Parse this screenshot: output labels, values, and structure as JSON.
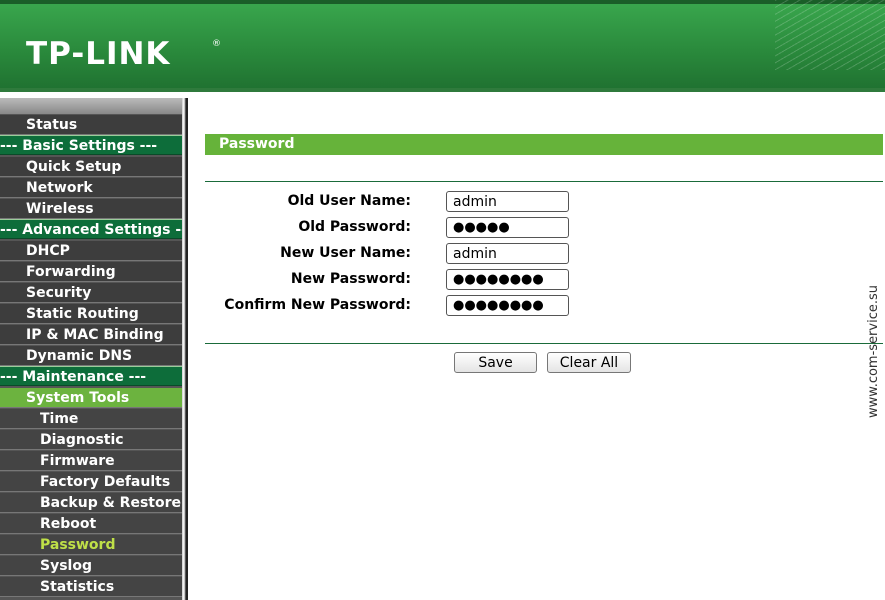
{
  "header": {
    "logo_text": "TP-LINK",
    "logo_mark": "®",
    "colors": {
      "header_green": "#2a8a3c",
      "section_green": "#0d6d3a",
      "highlight_green": "#6cb33f",
      "active_text": "#bfe048"
    }
  },
  "sidebar": {
    "items": [
      {
        "label": "Status",
        "type": "item"
      },
      {
        "label": "--- Basic Settings ---",
        "type": "section"
      },
      {
        "label": "Quick Setup",
        "type": "item"
      },
      {
        "label": "Network",
        "type": "item"
      },
      {
        "label": "Wireless",
        "type": "item"
      },
      {
        "label": "--- Advanced Settings ---",
        "type": "section"
      },
      {
        "label": "DHCP",
        "type": "item"
      },
      {
        "label": "Forwarding",
        "type": "item"
      },
      {
        "label": "Security",
        "type": "item"
      },
      {
        "label": "Static Routing",
        "type": "item"
      },
      {
        "label": "IP & MAC Binding",
        "type": "item"
      },
      {
        "label": "Dynamic DNS",
        "type": "item"
      },
      {
        "label": "--- Maintenance ---",
        "type": "section"
      },
      {
        "label": "System Tools",
        "type": "item",
        "expanded": true
      },
      {
        "label": "Time",
        "type": "subitem"
      },
      {
        "label": "Diagnostic",
        "type": "subitem"
      },
      {
        "label": "Firmware",
        "type": "subitem"
      },
      {
        "label": "Factory Defaults",
        "type": "subitem"
      },
      {
        "label": "Backup & Restore",
        "type": "subitem"
      },
      {
        "label": "Reboot",
        "type": "subitem"
      },
      {
        "label": "Password",
        "type": "subitem",
        "selected": true
      },
      {
        "label": "Syslog",
        "type": "subitem"
      },
      {
        "label": "Statistics",
        "type": "subitem"
      }
    ]
  },
  "main": {
    "title": "Password",
    "form": {
      "old_user_name": {
        "label": "Old User Name:",
        "value": "admin"
      },
      "old_password": {
        "label": "Old Password:",
        "value": "●●●●●"
      },
      "new_user_name": {
        "label": "New User Name:",
        "value": "admin"
      },
      "new_password": {
        "label": "New Password:",
        "value": "●●●●●●●●"
      },
      "confirm_new_password": {
        "label": "Confirm New Password:",
        "value": "●●●●●●●●"
      }
    },
    "buttons": {
      "save": "Save",
      "clear_all": "Clear All"
    }
  },
  "watermark": "www.com-service.su"
}
